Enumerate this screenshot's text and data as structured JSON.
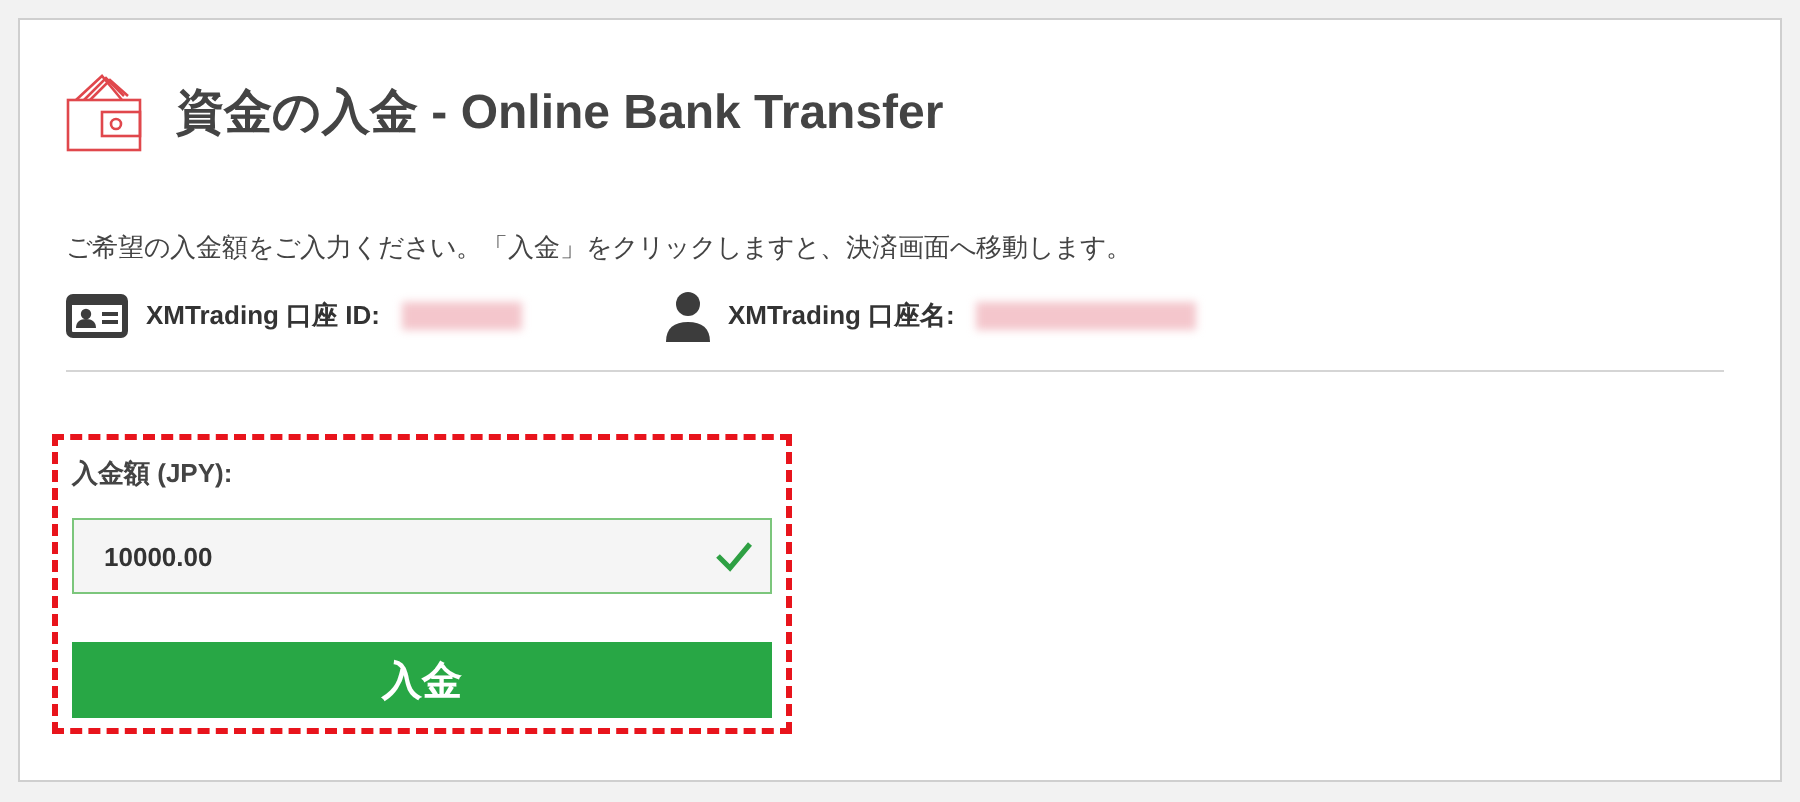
{
  "header": {
    "title": "資金の入金 - Online Bank Transfer"
  },
  "description": "ご希望の入金額をご入力ください。「入金」をクリックしますと、決済画面へ移動します。",
  "account_info": [
    {
      "kind": "id",
      "label": "XMTrading 口座 ID:"
    },
    {
      "kind": "name",
      "label": "XMTrading 口座名:"
    }
  ],
  "form": {
    "highlighted": true,
    "amount_label": "入金額 (JPY):",
    "amount_value": "10000.00",
    "valid": true,
    "submit_button": "入金"
  }
}
